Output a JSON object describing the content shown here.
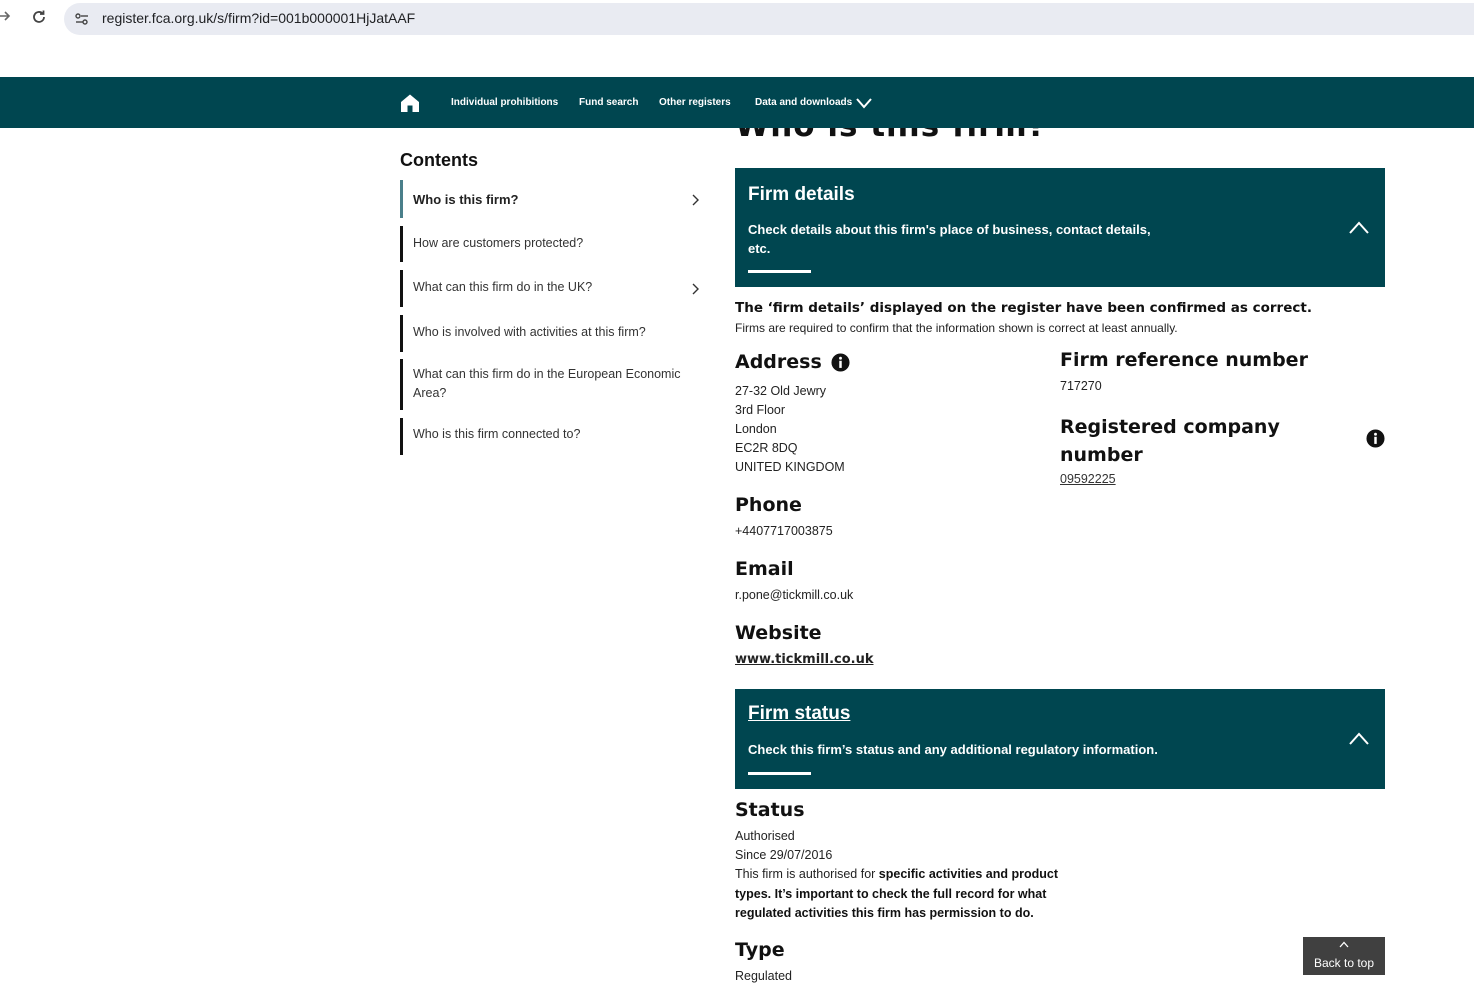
{
  "browser": {
    "url": "register.fca.org.uk/s/firm?id=001b000001HjJatAAF"
  },
  "topnav": {
    "items": [
      {
        "label": "Individual prohibitions"
      },
      {
        "label": "Fund search"
      },
      {
        "label": "Other registers"
      },
      {
        "label": "Data and downloads"
      }
    ]
  },
  "page_title": "Who is this firm?",
  "sidebar": {
    "heading": "Contents",
    "items": [
      {
        "label": "Who is this firm?",
        "active": true,
        "has_chevron": true
      },
      {
        "label": "How are customers protected?",
        "active": false,
        "has_chevron": false
      },
      {
        "label": "What can this firm do in the UK?",
        "active": false,
        "has_chevron": true
      },
      {
        "label": "Who is involved with activities at this firm?",
        "active": false,
        "has_chevron": false
      },
      {
        "label_line1": "What can this firm do in the European Economic",
        "label_line2": "Area?",
        "active": false,
        "has_chevron": false
      },
      {
        "label": "Who is this firm connected to?",
        "active": false,
        "has_chevron": false
      }
    ]
  },
  "firm_details_panel": {
    "title": "Firm details",
    "desc_line1": "Check details about this firm's place of business, contact details,",
    "desc_line2": "etc."
  },
  "confirmation": {
    "bold": "The ‘firm details’ displayed on the register have been confirmed as correct.",
    "small": "Firms are required to confirm that the information shown is correct at least annually."
  },
  "address": {
    "heading": "Address",
    "lines": [
      "27-32 Old Jewry",
      "3rd Floor",
      "London",
      "EC2R 8DQ",
      "UNITED KINGDOM"
    ]
  },
  "firm_reference": {
    "heading": "Firm reference number",
    "value": "717270"
  },
  "registered_company": {
    "heading_line1": "Registered company",
    "heading_line2": "number",
    "value": "09592225"
  },
  "phone": {
    "heading": "Phone",
    "value": "+4407717003875"
  },
  "email": {
    "heading": "Email",
    "value": "r.pone@tickmill.co.uk"
  },
  "website": {
    "heading": "Website",
    "value": "www.tickmill.co.uk"
  },
  "firm_status_panel": {
    "title": "Firm status",
    "desc": "Check this firm’s status and any additional regulatory information."
  },
  "status": {
    "heading": "Status",
    "value": "Authorised",
    "since": "Since 29/07/2016",
    "text_plain": "This firm is authorised for ",
    "text_bold": "specific activities and product types. It’s important to check the full record for what regulated activities this firm has permission to do."
  },
  "type": {
    "heading": "Type",
    "value": "Regulated"
  },
  "back_to_top": {
    "label": "Back to top"
  },
  "colors": {
    "nav_teal": "#004650",
    "back_to_top": "#404040"
  }
}
